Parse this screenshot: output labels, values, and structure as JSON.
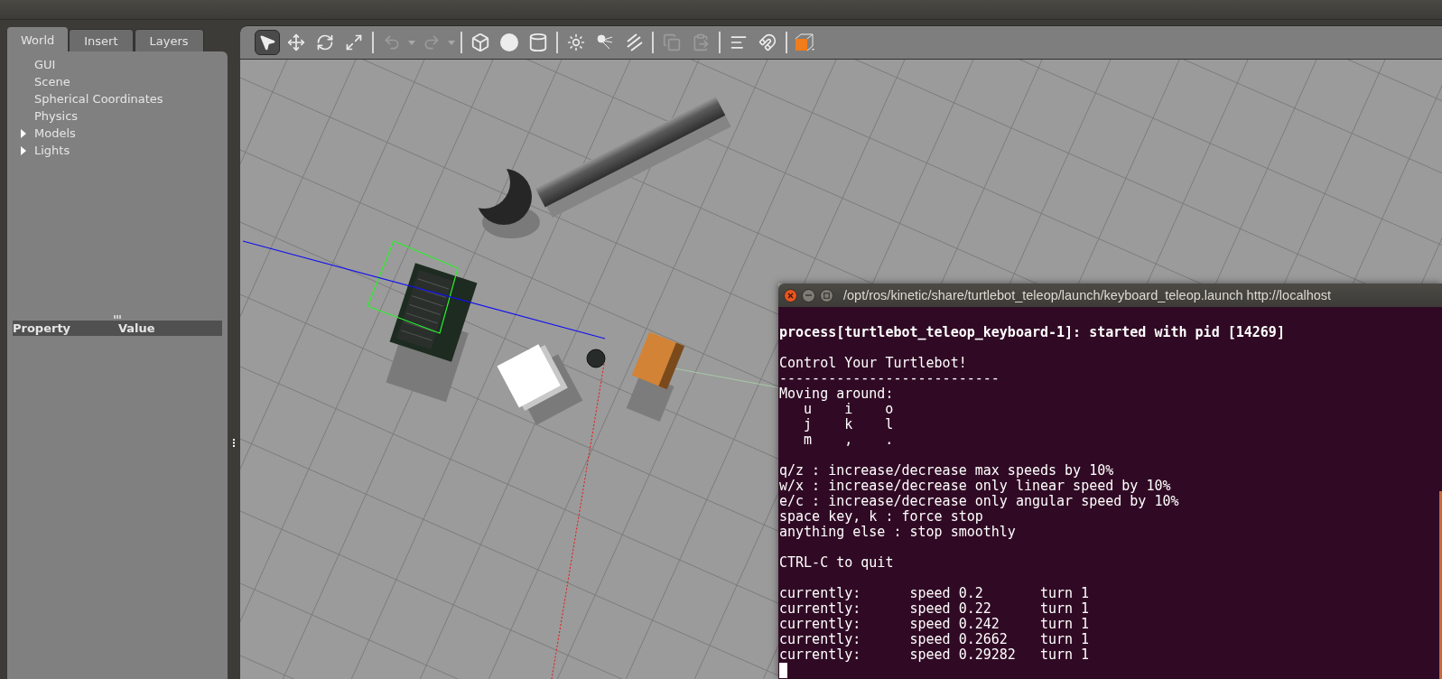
{
  "left_panel": {
    "tabs": [
      {
        "label": "World",
        "selected": true
      },
      {
        "label": "Insert",
        "selected": false
      },
      {
        "label": "Layers",
        "selected": false
      }
    ],
    "tree": [
      {
        "label": "GUI",
        "kind": "leaf"
      },
      {
        "label": "Scene",
        "kind": "leaf"
      },
      {
        "label": "Spherical Coordinates",
        "kind": "leaf"
      },
      {
        "label": "Physics",
        "kind": "leaf"
      },
      {
        "label": "Models",
        "kind": "group",
        "expanded": false
      },
      {
        "label": "Lights",
        "kind": "group",
        "expanded": false
      }
    ],
    "property_table": {
      "columns": [
        "Property",
        "Value"
      ]
    }
  },
  "toolbar": {
    "groups": [
      {
        "tools": [
          {
            "selected": true,
            "disabled": false
          },
          {
            "selected": false,
            "disabled": false
          },
          {
            "selected": false,
            "disabled": false
          },
          {
            "selected": false,
            "disabled": false
          }
        ]
      },
      {
        "tools": [
          {
            "selected": false,
            "disabled": true
          },
          {
            "selected": false,
            "disabled": true
          }
        ]
      },
      {
        "tools": [
          {
            "selected": false,
            "disabled": false
          },
          {
            "selected": false,
            "disabled": false
          },
          {
            "selected": false,
            "disabled": false
          }
        ]
      },
      {
        "tools": [
          {
            "selected": false,
            "disabled": false
          },
          {
            "selected": false,
            "disabled": false
          },
          {
            "selected": false,
            "disabled": false
          }
        ]
      },
      {
        "tools": [
          {
            "selected": false,
            "disabled": true
          },
          {
            "selected": false,
            "disabled": true
          }
        ]
      },
      {
        "tools": [
          {
            "selected": false,
            "disabled": false
          },
          {
            "selected": false,
            "disabled": false
          }
        ]
      },
      {
        "tools": [
          {
            "selected": false,
            "disabled": false
          }
        ]
      }
    ]
  },
  "terminal": {
    "title": "/opt/ros/kinetic/share/turtlebot_teleop/launch/keyboard_teleop.launch http://localhost",
    "blocks": [
      {
        "kind": "status",
        "lines": [
          "process[turtlebot_teleop_keyboard-1]: started with pid [14269]"
        ]
      },
      {
        "kind": "text",
        "lines": [
          "Control Your Turtlebot!",
          "---------------------------",
          "Moving around:"
        ]
      },
      {
        "kind": "keys",
        "rows": [
          [
            "u",
            "i",
            "o"
          ],
          [
            "j",
            "k",
            "l"
          ],
          [
            "m",
            ",",
            "."
          ]
        ]
      },
      {
        "kind": "text",
        "lines": [
          "q/z : increase/decrease max speeds by 10%",
          "w/x : increase/decrease only linear speed by 10%",
          "e/c : increase/decrease only angular speed by 10%",
          "space key, k : force stop",
          "anything else : stop smoothly"
        ]
      },
      {
        "kind": "text",
        "lines": [
          "CTRL-C to quit"
        ]
      },
      {
        "kind": "readings",
        "rows": [
          [
            "currently:",
            "speed 0.2",
            "turn 1"
          ],
          [
            "currently:",
            "speed 0.22",
            "turn 1"
          ],
          [
            "currently:",
            "speed 0.242",
            "turn 1"
          ],
          [
            "currently:",
            "speed 0.2662",
            "turn 1"
          ],
          [
            "currently:",
            "speed 0.29282",
            "turn 1"
          ]
        ]
      }
    ]
  }
}
